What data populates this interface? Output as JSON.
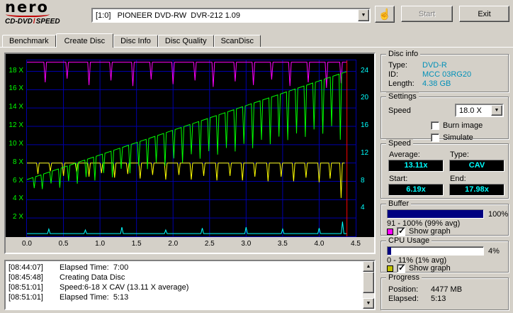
{
  "colors": {
    "window_bg": "#d4d0c8",
    "chart_bg": "#000000",
    "grid": "#0000aa",
    "end_marker": "#ff0000",
    "left_axis_text": "#00ff00",
    "right_axis_text": "#00ffff",
    "disc_value_text": "#0090b8",
    "speed_box_text": "#00ffff",
    "buffer_bar_fill": "#000080",
    "buffer_swatch": "#ff00ff",
    "cpu_swatch": "#c0c000"
  },
  "toolbar": {
    "logo_main": "nero",
    "logo_sub1": "CD-DVD",
    "logo_slash": "/",
    "logo_sub2": "SPEED",
    "device_selector": "[1:0]   PIONEER DVD-RW  DVR-212 1.09",
    "glove_icon": "☝",
    "start_label": "Start",
    "exit_label": "Exit"
  },
  "tabs": [
    {
      "label": "Benchmark",
      "active": false
    },
    {
      "label": "Create Disc",
      "active": true
    },
    {
      "label": "Disc Info",
      "active": false
    },
    {
      "label": "Disc Quality",
      "active": false
    },
    {
      "label": "ScanDisc",
      "active": false
    }
  ],
  "chart_data": {
    "type": "line",
    "x_range": [
      0,
      4.5
    ],
    "x_unit": "GB",
    "x_ticks": [
      [
        0,
        "0.0"
      ],
      [
        0.5,
        "0.5"
      ],
      [
        1,
        "1.0"
      ],
      [
        1.5,
        "1.5"
      ],
      [
        2,
        "2.0"
      ],
      [
        2.5,
        "2.5"
      ],
      [
        3,
        "3.0"
      ],
      [
        3.5,
        "3.5"
      ],
      [
        4,
        "4.0"
      ],
      [
        4.5,
        "4.5"
      ]
    ],
    "left_axis": {
      "max": 19.2,
      "ticks": [
        [
          2,
          "2 X"
        ],
        [
          4,
          "4 X"
        ],
        [
          6,
          "6 X"
        ],
        [
          8,
          "8 X"
        ],
        [
          10,
          "10 X"
        ],
        [
          12,
          "12 X"
        ],
        [
          14,
          "14 X"
        ],
        [
          16,
          "16 X"
        ],
        [
          18,
          "18 X"
        ]
      ]
    },
    "right_axis": {
      "max": 25.6,
      "ticks": [
        [
          4,
          "4"
        ],
        [
          8,
          "8"
        ],
        [
          12,
          "12"
        ],
        [
          16,
          "16"
        ],
        [
          20,
          "20"
        ],
        [
          24,
          "24"
        ]
      ]
    },
    "end_marker_x": 4.38,
    "series": [
      {
        "name": "buffer",
        "color": "#ff00ff",
        "start_x": 0,
        "start_y": 19.0,
        "end_x": 4.38,
        "end_y": 19.0,
        "dips": [
          [
            0.25,
            2.2
          ],
          [
            0.55,
            1.8
          ],
          [
            0.85,
            2.5
          ],
          [
            1.15,
            2.0
          ],
          [
            1.45,
            2.6
          ],
          [
            1.7,
            1.9
          ],
          [
            2.0,
            2.4
          ],
          [
            2.3,
            2.0
          ],
          [
            2.55,
            2.7
          ],
          [
            2.85,
            2.1
          ],
          [
            3.1,
            2.5
          ],
          [
            3.35,
            1.9
          ],
          [
            3.6,
            2.6
          ],
          [
            3.85,
            2.2
          ],
          [
            4.1,
            2.8
          ],
          [
            4.3,
            2.3
          ]
        ]
      },
      {
        "name": "secondary-speed",
        "color": "#ffff00",
        "start_x": 0,
        "start_y": 8.0,
        "end_x": 4.35,
        "end_y": 8.0,
        "dips": [
          [
            0.15,
            1.2
          ],
          [
            0.32,
            0.9
          ],
          [
            0.5,
            1.4
          ],
          [
            0.68,
            1.0
          ],
          [
            0.85,
            1.5
          ],
          [
            1.02,
            1.1
          ],
          [
            1.2,
            1.6
          ],
          [
            1.38,
            1.2
          ],
          [
            1.55,
            1.7
          ],
          [
            1.72,
            1.3
          ],
          [
            1.9,
            1.8
          ],
          [
            2.08,
            1.3
          ],
          [
            2.25,
            1.8
          ],
          [
            2.42,
            1.4
          ],
          [
            2.6,
            1.9
          ],
          [
            2.78,
            1.4
          ],
          [
            2.95,
            1.9
          ],
          [
            3.12,
            1.5
          ],
          [
            3.3,
            2.0
          ],
          [
            3.48,
            1.5
          ],
          [
            3.65,
            2.0
          ],
          [
            3.82,
            1.6
          ],
          [
            4.0,
            2.1
          ],
          [
            4.15,
            1.7
          ],
          [
            4.3,
            3.8
          ]
        ]
      },
      {
        "name": "cpu",
        "color": "#00ffff",
        "start_x": 0,
        "start_y": 0.3,
        "end_x": 4.38,
        "end_y": 0.3,
        "dips": [
          [
            0.3,
            -0.5
          ],
          [
            0.8,
            -0.4
          ],
          [
            1.3,
            -0.7
          ],
          [
            1.9,
            -0.4
          ],
          [
            2.4,
            -0.6
          ],
          [
            3.0,
            -0.7
          ],
          [
            3.5,
            -0.5
          ],
          [
            4.0,
            -0.6
          ],
          [
            4.32,
            -1.3
          ]
        ]
      },
      {
        "name": "write-speed",
        "color": "#00ff00",
        "start_x": 0,
        "start_y": 6.19,
        "end_x": 4.38,
        "end_y": 17.98,
        "dips": [
          [
            0.1,
            1.2
          ],
          [
            0.21,
            1.6
          ],
          [
            0.33,
            1.3
          ],
          [
            0.45,
            2.1
          ],
          [
            0.57,
            1.7
          ],
          [
            0.69,
            2.3
          ],
          [
            0.81,
            1.9
          ],
          [
            0.93,
            2.6
          ],
          [
            1.05,
            2.1
          ],
          [
            1.17,
            2.9
          ],
          [
            1.29,
            2.3
          ],
          [
            1.41,
            3.1
          ],
          [
            1.53,
            2.6
          ],
          [
            1.65,
            3.3
          ],
          [
            1.77,
            2.9
          ],
          [
            1.89,
            3.6
          ],
          [
            2.01,
            3.1
          ],
          [
            2.13,
            3.9
          ],
          [
            2.25,
            3.3
          ],
          [
            2.37,
            4.1
          ],
          [
            2.49,
            3.6
          ],
          [
            2.61,
            4.3
          ],
          [
            2.73,
            3.9
          ],
          [
            2.85,
            4.6
          ],
          [
            2.97,
            4.1
          ],
          [
            3.09,
            4.9
          ],
          [
            3.21,
            4.3
          ],
          [
            3.33,
            5.1
          ],
          [
            3.45,
            4.6
          ],
          [
            3.57,
            5.3
          ],
          [
            3.69,
            4.9
          ],
          [
            3.81,
            5.6
          ],
          [
            3.93,
            5.1
          ],
          [
            4.05,
            5.9
          ],
          [
            4.17,
            5.4
          ],
          [
            4.29,
            7.2
          ]
        ]
      }
    ]
  },
  "disc_info": {
    "title": "Disc info",
    "rows": [
      {
        "label": "Type:",
        "value": "DVD-R"
      },
      {
        "label": "ID:",
        "value": "MCC 03RG20"
      },
      {
        "label": "Length:",
        "value": "4.38 GB"
      }
    ]
  },
  "settings": {
    "title": "Settings",
    "speed_label": "Speed",
    "speed_value": "18.0 X",
    "checkboxes": [
      {
        "label": "Burn image",
        "checked": false
      },
      {
        "label": "Simulate",
        "checked": false
      }
    ]
  },
  "speed_panel": {
    "title": "Speed",
    "average_label": "Average:",
    "average": "13.11x",
    "type_label": "Type:",
    "type": "CAV",
    "start_label": "Start:",
    "start": "6.19x",
    "end_label": "End:",
    "end": "17.98x"
  },
  "buffer_panel": {
    "title": "Buffer",
    "fill_pct": 100,
    "percent": "100%",
    "range_text": "91 - 100% (99% avg)",
    "show_graph": "Show graph",
    "checked": true
  },
  "cpu_panel": {
    "title": "CPU Usage",
    "fill_pct": 4,
    "percent": "4%",
    "range_text": "0 - 11% (1% avg)",
    "show_graph": "Show graph",
    "checked": true
  },
  "progress_panel": {
    "title": "Progress",
    "position_label": "Position:",
    "position": "4477 MB",
    "elapsed_label": "Elapsed:",
    "elapsed": "5:13"
  },
  "log": {
    "lines": [
      {
        "time": "[08:44:07]",
        "text": "Elapsed Time:  7:00"
      },
      {
        "time": "[08:45:48]",
        "text": "Creating Data Disc"
      },
      {
        "time": "[08:51:01]",
        "text": "Speed:6-18 X CAV (13.11 X average)"
      },
      {
        "time": "[08:51:01]",
        "text": "Elapsed Time:  5:13"
      }
    ]
  }
}
